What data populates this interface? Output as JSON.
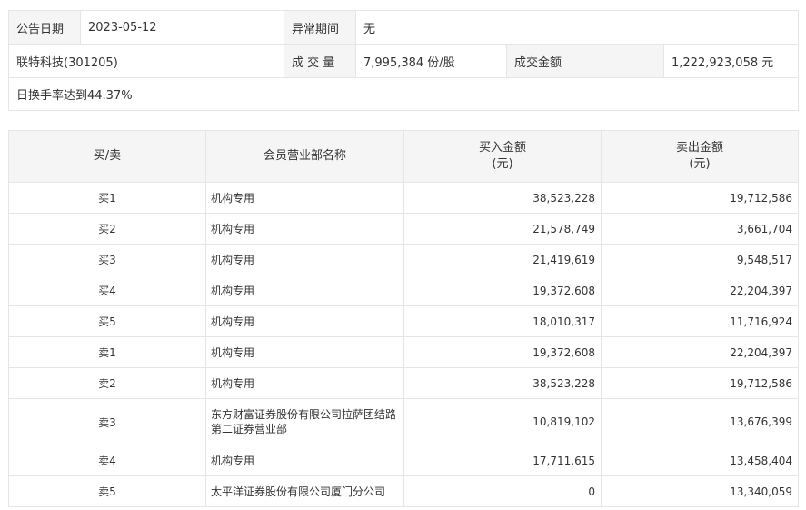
{
  "summary": {
    "announce_date_label": "公告日期",
    "announce_date": "2023-05-12",
    "abnormal_period_label": "异常期间",
    "abnormal_period": "无",
    "stock_name": "联特科技(301205)",
    "volume_label": "成 交 量",
    "volume": "7,995,384 份/股",
    "amount_label": "成交金额",
    "amount": "1,222,923,058 元",
    "note": "日换手率达到44.37%"
  },
  "members": {
    "headers": {
      "side": "买/卖",
      "name": "会员营业部名称",
      "buy": "买入金额",
      "buy_unit": "(元)",
      "sell": "卖出金额",
      "sell_unit": "(元)"
    },
    "rows": [
      {
        "side": "买1",
        "name": "机构专用",
        "buy": "38,523,228",
        "sell": "19,712,586"
      },
      {
        "side": "买2",
        "name": "机构专用",
        "buy": "21,578,749",
        "sell": "3,661,704"
      },
      {
        "side": "买3",
        "name": "机构专用",
        "buy": "21,419,619",
        "sell": "9,548,517"
      },
      {
        "side": "买4",
        "name": "机构专用",
        "buy": "19,372,608",
        "sell": "22,204,397"
      },
      {
        "side": "买5",
        "name": "机构专用",
        "buy": "18,010,317",
        "sell": "11,716,924"
      },
      {
        "side": "卖1",
        "name": "机构专用",
        "buy": "19,372,608",
        "sell": "22,204,397"
      },
      {
        "side": "卖2",
        "name": "机构专用",
        "buy": "38,523,228",
        "sell": "19,712,586"
      },
      {
        "side": "卖3",
        "name": "东方财富证券股份有限公司拉萨团结路第二证券营业部",
        "buy": "10,819,102",
        "sell": "13,676,399"
      },
      {
        "side": "卖4",
        "name": "机构专用",
        "buy": "17,711,615",
        "sell": "13,458,404"
      },
      {
        "side": "卖5",
        "name": "太平洋证券股份有限公司厦门分公司",
        "buy": "0",
        "sell": "13,340,059"
      }
    ]
  }
}
